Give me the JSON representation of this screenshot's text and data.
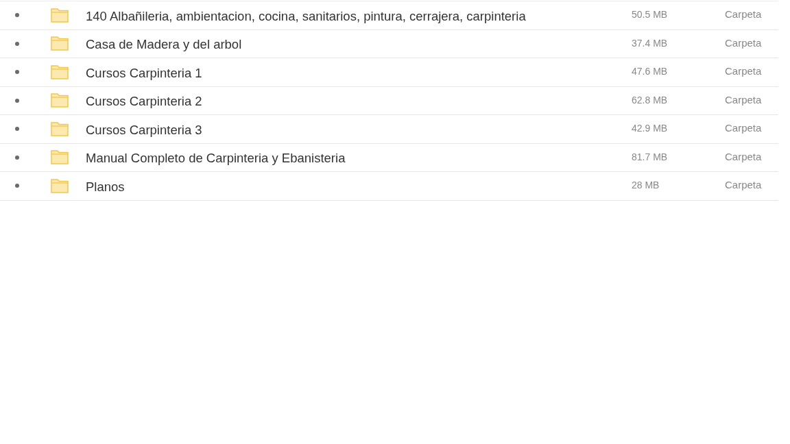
{
  "files": [
    {
      "name": "140 Albañileria, ambientacion, cocina, sanitarios, pintura, cerrajera, carpinteria",
      "size": "50.5 MB",
      "type": "Carpeta"
    },
    {
      "name": "Casa de Madera y del arbol",
      "size": "37.4 MB",
      "type": "Carpeta"
    },
    {
      "name": "Cursos Carpinteria 1",
      "size": "47.6 MB",
      "type": "Carpeta"
    },
    {
      "name": "Cursos Carpinteria 2",
      "size": "62.8 MB",
      "type": "Carpeta"
    },
    {
      "name": "Cursos Carpinteria 3",
      "size": "42.9 MB",
      "type": "Carpeta"
    },
    {
      "name": "Manual Completo de Carpinteria y Ebanisteria",
      "size": "81.7 MB",
      "type": "Carpeta"
    },
    {
      "name": "Planos",
      "size": "28 MB",
      "type": "Carpeta"
    }
  ]
}
